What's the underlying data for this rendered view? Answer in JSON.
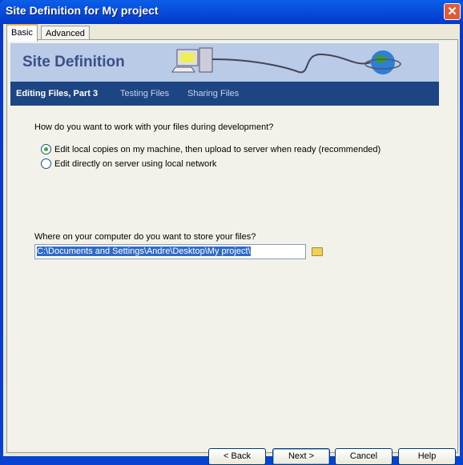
{
  "window": {
    "title": "Site Definition for My project",
    "close_icon": "close-icon"
  },
  "tabs": [
    {
      "label": "Basic",
      "active": true
    },
    {
      "label": "Advanced",
      "active": false
    }
  ],
  "banner": {
    "title": "Site Definition",
    "illustration": "computer-network-globe-icon"
  },
  "steps": [
    {
      "label": "Editing Files, Part 3",
      "current": true
    },
    {
      "label": "Testing Files",
      "current": false
    },
    {
      "label": "Sharing Files",
      "current": false
    }
  ],
  "question1": "How do you want to work with your files during development?",
  "options": [
    {
      "label": "Edit local copies on my machine, then upload to server when ready (recommended)",
      "selected": true
    },
    {
      "label": "Edit directly on server using local network",
      "selected": false
    }
  ],
  "question2": "Where on your computer do you want to store your files?",
  "path_value": "C:\\Documents and Settings\\Andre\\Desktop\\My project\\",
  "buttons": {
    "back": "< Back",
    "next": "Next >",
    "cancel": "Cancel",
    "help": "Help"
  }
}
